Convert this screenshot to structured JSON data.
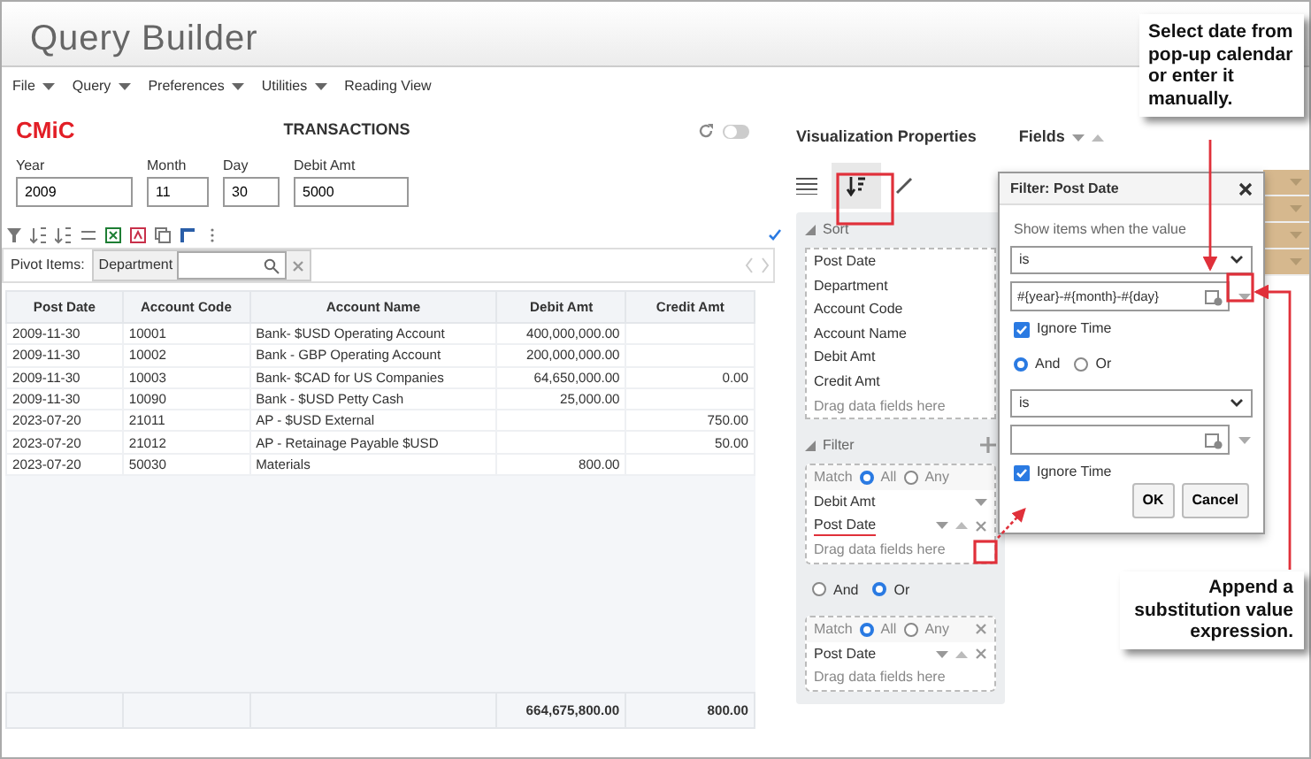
{
  "app_title": "Query Builder",
  "menu": [
    {
      "label": "File",
      "has_menu": true
    },
    {
      "label": "Query",
      "has_menu": true
    },
    {
      "label": "Preferences",
      "has_menu": true
    },
    {
      "label": "Utilities",
      "has_menu": true
    },
    {
      "label": "Reading View",
      "has_menu": false
    }
  ],
  "report": {
    "logo": "CMiC",
    "title": "TRANSACTIONS",
    "parameters": [
      {
        "label": "Year",
        "value": "2009"
      },
      {
        "label": "Month",
        "value": "11"
      },
      {
        "label": "Day",
        "value": "30"
      },
      {
        "label": "Debit Amt",
        "value": "5000"
      }
    ],
    "pivot_label": "Pivot Items:",
    "pivot_item": "Department",
    "columns": [
      "Post Date",
      "Account Code",
      "Account Name",
      "Debit Amt",
      "Credit Amt"
    ],
    "rows": [
      [
        "2009-11-30",
        "10001",
        "Bank- $USD Operating Account",
        "400,000,000.00",
        ""
      ],
      [
        "2009-11-30",
        "10002",
        "Bank - GBP Operating Account",
        "200,000,000.00",
        ""
      ],
      [
        "2009-11-30",
        "10003",
        "Bank- $CAD for US Companies",
        "64,650,000.00",
        "0.00"
      ],
      [
        "2009-11-30",
        "10090",
        "Bank - $USD Petty Cash",
        "25,000.00",
        ""
      ],
      [
        "2023-07-20",
        "21011",
        "AP - $USD External",
        "",
        "750.00"
      ],
      [
        "2023-07-20",
        "21012",
        "AP - Retainage Payable $USD",
        "",
        "50.00"
      ],
      [
        "2023-07-20",
        "50030",
        "Materials",
        "800.00",
        ""
      ]
    ],
    "toggle_on": false,
    "totals": {
      "debit_amt": "664,675,800.00",
      "credit_amt": "800.00"
    }
  },
  "viz": {
    "title": "Visualization Properties",
    "fields_label": "Fields",
    "sort": {
      "title": "Sort",
      "items": [
        "Post Date",
        "Department",
        "Account Code",
        "Account Name",
        "Debit Amt",
        "Credit Amt"
      ],
      "hint": "Drag data fields here"
    },
    "filter": {
      "title": "Filter",
      "groups": [
        {
          "match_label": "Match",
          "options": [
            {
              "label": "All",
              "selected": true
            },
            {
              "label": "Any",
              "selected": false
            }
          ],
          "items": [
            {
              "label": "Debit Amt",
              "highlighted": false
            },
            {
              "label": "Post Date",
              "highlighted": true
            }
          ],
          "hint": "Drag data fields here",
          "closable": false
        },
        {
          "match_label": "Match",
          "options": [
            {
              "label": "All",
              "selected": true
            },
            {
              "label": "Any",
              "selected": false
            }
          ],
          "items": [
            {
              "label": "Post Date",
              "highlighted": false
            }
          ],
          "hint": "Drag data fields here",
          "closable": true
        }
      ],
      "join_options": [
        {
          "label": "And",
          "selected": false
        },
        {
          "label": "Or",
          "selected": true
        }
      ]
    }
  },
  "dialog": {
    "title": "Filter: Post Date",
    "prompt": "Show items when the value",
    "conditions": [
      {
        "operator": "is",
        "value": "#{year}-#{month}-#{day}",
        "ignore_time_label": "Ignore Time",
        "ignore_time": true
      },
      {
        "operator": "is",
        "ignore_time_label": "Ignore Time",
        "ignore_time": true
      }
    ],
    "join_options": [
      {
        "label": "And",
        "selected": true
      },
      {
        "label": "Or",
        "selected": false
      }
    ],
    "buttons": [
      "OK",
      "Cancel"
    ]
  },
  "callouts": [
    "Select date from pop-up calendar or enter it manually.",
    "Append a substitution value expression."
  ]
}
